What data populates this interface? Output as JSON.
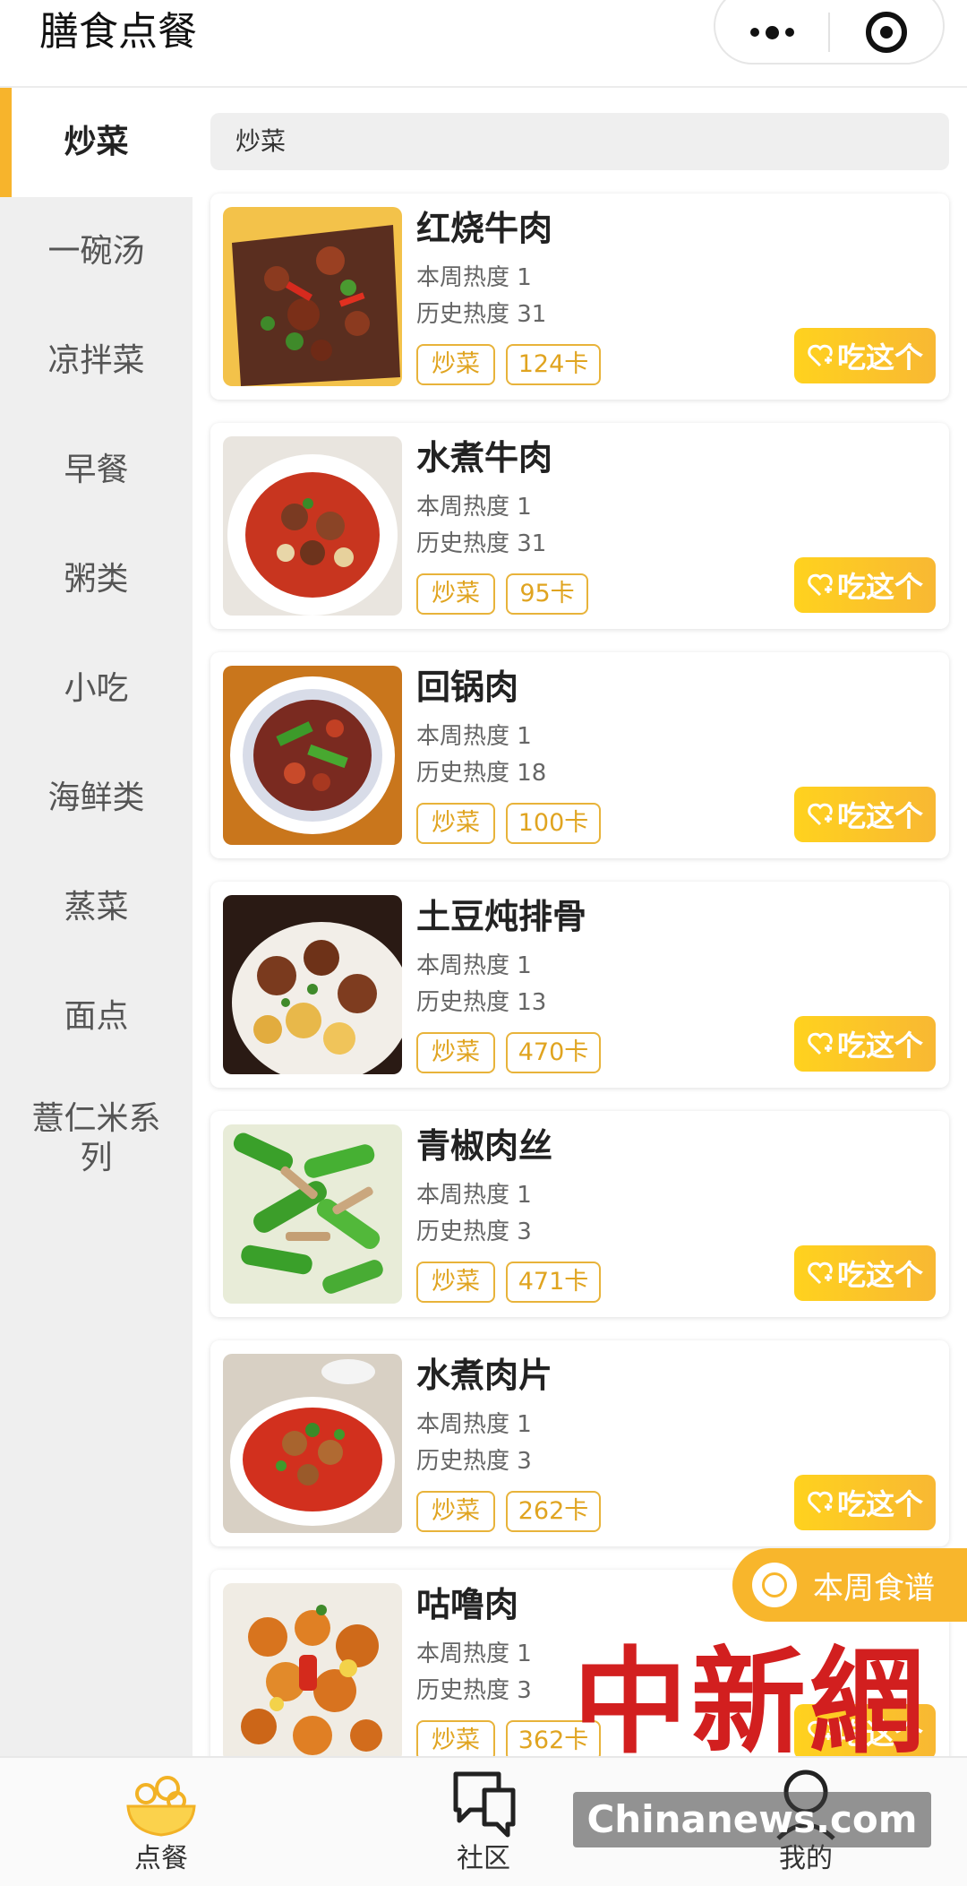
{
  "header": {
    "title": "膳食点餐"
  },
  "search": {
    "value": "炒菜"
  },
  "sidebar": {
    "items": [
      {
        "label": "炒菜",
        "active": true
      },
      {
        "label": "一碗汤"
      },
      {
        "label": "凉拌菜"
      },
      {
        "label": "早餐"
      },
      {
        "label": "粥类"
      },
      {
        "label": "小吃"
      },
      {
        "label": "海鲜类"
      },
      {
        "label": "蒸菜"
      },
      {
        "label": "面点"
      },
      {
        "label": "薏仁米系列"
      }
    ]
  },
  "colors": {
    "accent": "#f7b42c",
    "tag_border": "#e8b33a",
    "button_from": "#ffd21e",
    "button_to": "#f8b833"
  },
  "dishes": [
    {
      "name": "红烧牛肉",
      "week": "本周热度 1",
      "history": "历史热度 31",
      "tag": "炒菜",
      "kcal": "124卡",
      "action": "吃这个"
    },
    {
      "name": "水煮牛肉",
      "week": "本周热度 1",
      "history": "历史热度 31",
      "tag": "炒菜",
      "kcal": "95卡",
      "action": "吃这个"
    },
    {
      "name": "回锅肉",
      "week": "本周热度 1",
      "history": "历史热度 18",
      "tag": "炒菜",
      "kcal": "100卡",
      "action": "吃这个"
    },
    {
      "name": "土豆炖排骨",
      "week": "本周热度 1",
      "history": "历史热度 13",
      "tag": "炒菜",
      "kcal": "470卡",
      "action": "吃这个"
    },
    {
      "name": "青椒肉丝",
      "week": "本周热度 1",
      "history": "历史热度 3",
      "tag": "炒菜",
      "kcal": "471卡",
      "action": "吃这个"
    },
    {
      "name": "水煮肉片",
      "week": "本周热度 1",
      "history": "历史热度 3",
      "tag": "炒菜",
      "kcal": "262卡",
      "action": "吃这个"
    },
    {
      "name": "咕噜肉",
      "week": "本周热度 1",
      "history": "历史热度 3",
      "tag": "炒菜",
      "kcal": "362卡",
      "action": "吃这个"
    }
  ],
  "floating": {
    "weekly_menu": "本周食谱"
  },
  "tabbar": {
    "items": [
      {
        "label": "点餐",
        "icon": "food-bowl-icon"
      },
      {
        "label": "社区",
        "icon": "chat-bubbles-icon"
      },
      {
        "label": "我的",
        "icon": "person-icon"
      }
    ]
  },
  "watermark": {
    "cn": "中新網",
    "en": "Chinanews.com"
  }
}
